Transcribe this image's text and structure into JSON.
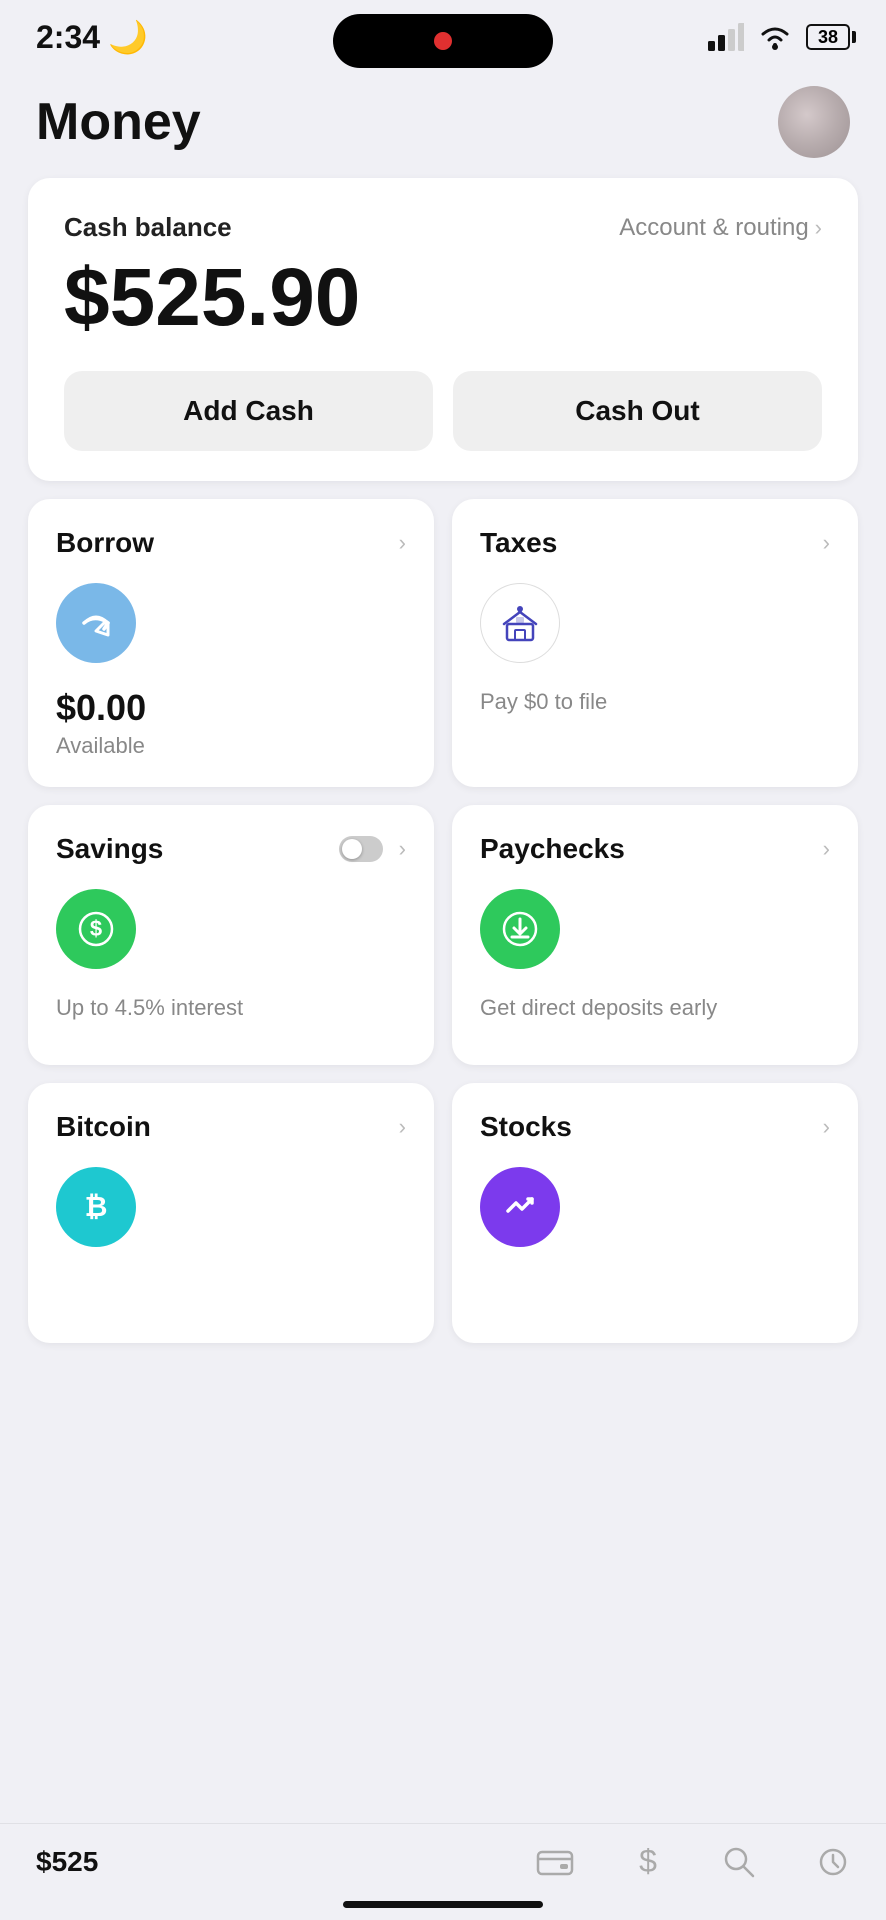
{
  "statusBar": {
    "time": "2:34",
    "moonIcon": "🌙",
    "batteryLevel": "38"
  },
  "header": {
    "title": "Money"
  },
  "cashBalance": {
    "label": "Cash balance",
    "amount": "$525.90",
    "accountRoutingLabel": "Account & routing",
    "addCashLabel": "Add Cash",
    "cashOutLabel": "Cash Out"
  },
  "cards": [
    {
      "id": "borrow",
      "title": "Borrow",
      "iconType": "blue",
      "iconSymbol": "↩",
      "amount": "$0.00",
      "sub": "Available",
      "desc": null
    },
    {
      "id": "taxes",
      "title": "Taxes",
      "iconType": "gray-outline",
      "iconSymbol": "🏛",
      "amount": null,
      "sub": null,
      "desc": "Pay $0 to file"
    },
    {
      "id": "savings",
      "title": "Savings",
      "iconType": "green",
      "iconSymbol": "$",
      "amount": null,
      "sub": null,
      "desc": "Up to 4.5% interest"
    },
    {
      "id": "paychecks",
      "title": "Paychecks",
      "iconType": "green-download",
      "iconSymbol": "↓",
      "amount": null,
      "sub": null,
      "desc": "Get direct deposits early"
    },
    {
      "id": "bitcoin",
      "title": "Bitcoin",
      "iconType": "teal",
      "iconSymbol": "₿",
      "amount": null,
      "sub": null,
      "desc": null
    },
    {
      "id": "stocks",
      "title": "Stocks",
      "iconType": "purple",
      "iconSymbol": "~",
      "amount": null,
      "sub": null,
      "desc": null
    }
  ],
  "bottomNav": {
    "amount": "$525",
    "icons": [
      "wallet",
      "dollar",
      "search",
      "history"
    ]
  }
}
